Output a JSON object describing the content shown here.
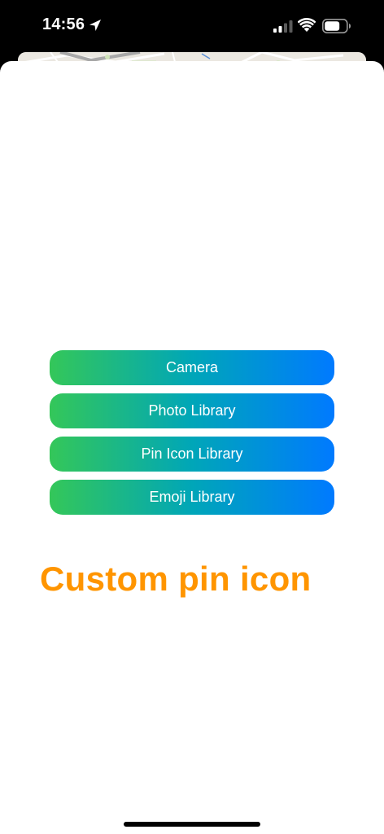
{
  "status_bar": {
    "time": "14:56",
    "icons": [
      "location-arrow-icon",
      "cellular-signal-icon",
      "wifi-icon",
      "battery-icon"
    ]
  },
  "sheet": {
    "buttons": [
      {
        "label": "Camera"
      },
      {
        "label": "Photo Library"
      },
      {
        "label": "Pin Icon Library"
      },
      {
        "label": "Emoji Library"
      }
    ],
    "headline": "Custom pin icon"
  },
  "colors": {
    "gradient_start": "#34c759",
    "gradient_end": "#007aff",
    "headline": "#ff9500",
    "button_text": "#ffffff",
    "sheet_background": "#ffffff"
  }
}
